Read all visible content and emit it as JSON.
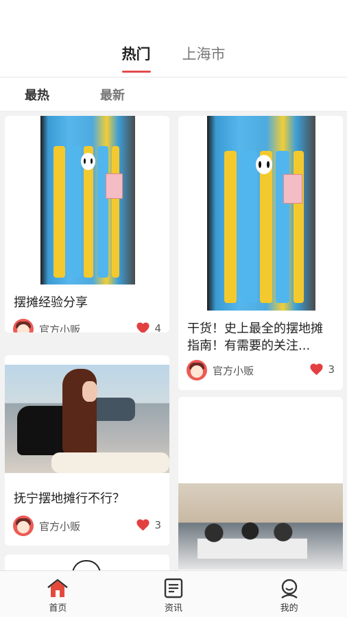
{
  "header": {
    "tabs": [
      {
        "label": "热门",
        "active": true
      },
      {
        "label": "上海市",
        "active": false
      }
    ],
    "accent_color": "#e34b4b"
  },
  "subtabs": [
    {
      "label": "最热",
      "active": true
    },
    {
      "label": "最新",
      "active": false
    }
  ],
  "feed": {
    "cards": [
      {
        "title": "摆摊经验分享",
        "author": "官方小贩",
        "likes": "4",
        "image": "tissue-pack-photo"
      },
      {
        "title": "干货！史上最全的摆地摊指南！有需要的关注...",
        "author": "官方小贩",
        "likes": "3",
        "image": "tissue-pack-photo"
      },
      {
        "title": "抚宁摆地摊行不行？",
        "author": "官方小贩",
        "likes": "3",
        "image": "street-vendor-photo"
      },
      {
        "title": "",
        "author": "",
        "likes": "",
        "image": "classroom-photo"
      }
    ]
  },
  "bottom_nav": {
    "items": [
      {
        "label": "首页",
        "icon": "home-icon",
        "active": true
      },
      {
        "label": "资讯",
        "icon": "news-icon",
        "active": false
      },
      {
        "label": "我的",
        "icon": "profile-icon",
        "active": false
      }
    ]
  }
}
